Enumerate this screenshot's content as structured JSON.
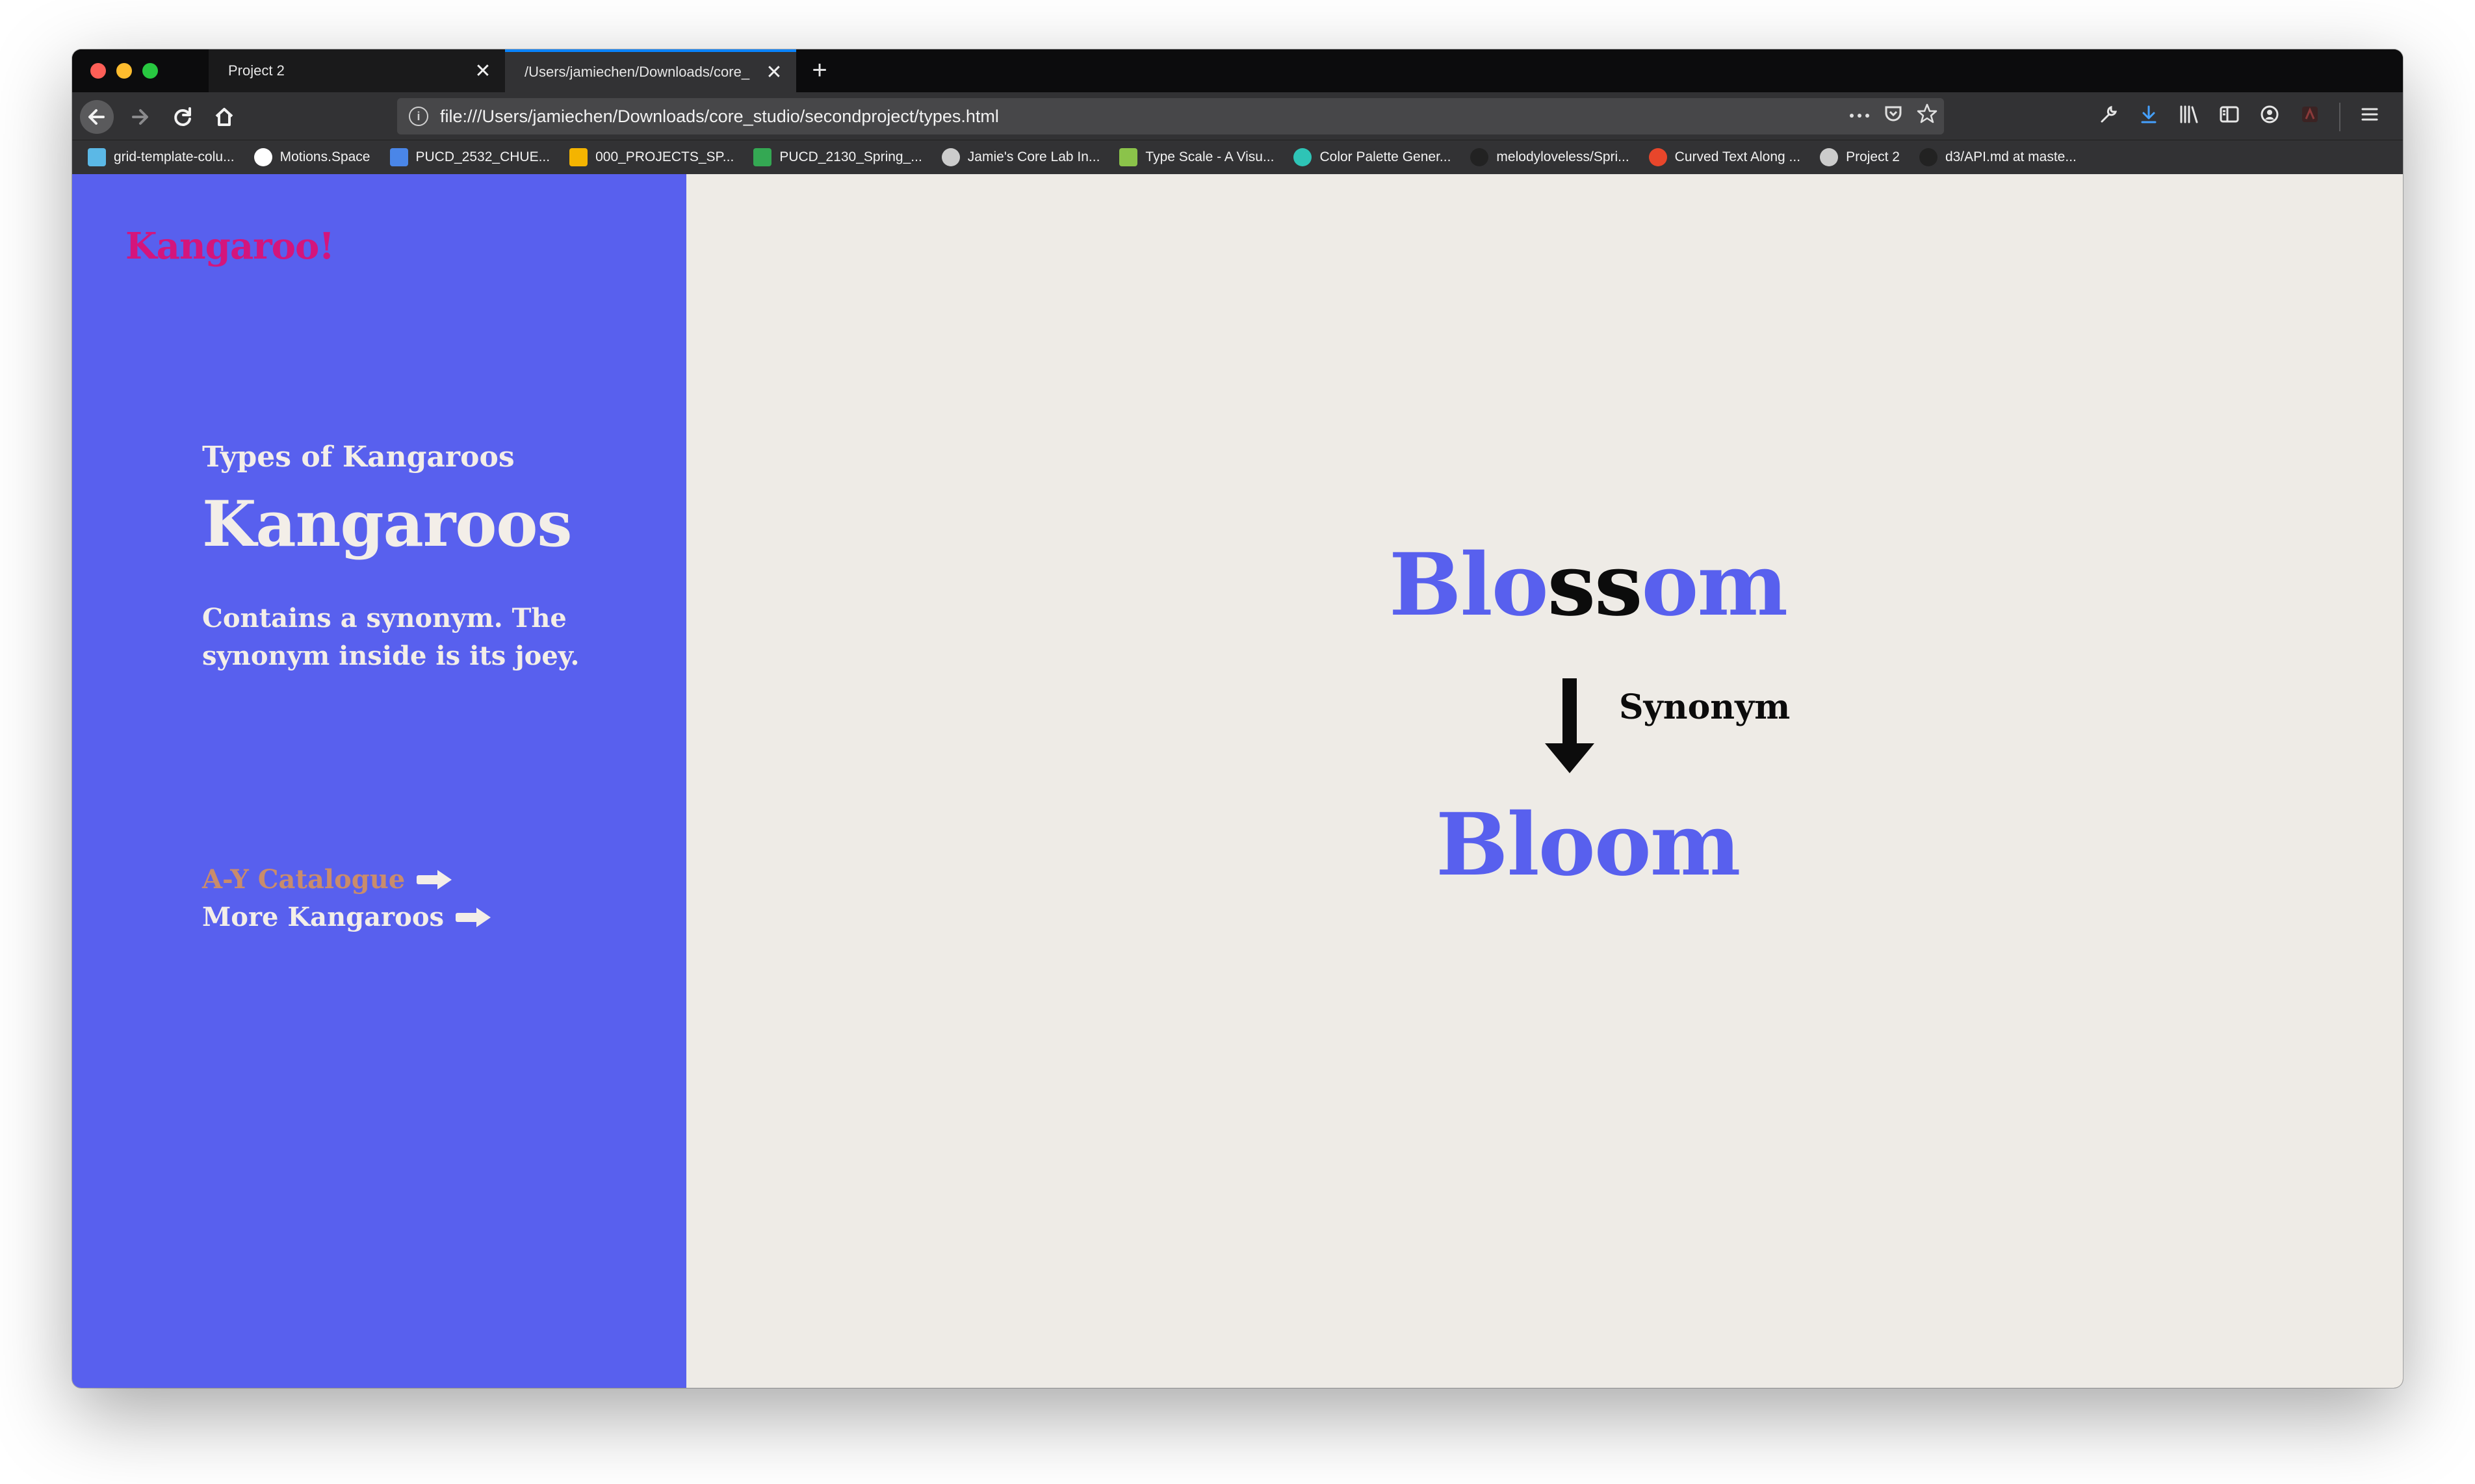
{
  "browser": {
    "tabs": [
      {
        "label": "Project 2",
        "close": "✕"
      },
      {
        "label": "/Users/jamiechen/Downloads/core_",
        "close": "✕"
      }
    ],
    "new_tab": "+",
    "url": "file:///Users/jamiechen/Downloads/core_studio/secondproject/types.html",
    "info_icon": "i",
    "bookmarks": [
      {
        "label": "grid-template-colu...",
        "icon": "codepen-icon",
        "color": "#5bb8e6"
      },
      {
        "label": "Motions.Space",
        "icon": "circle-icon",
        "color": "#ffffff"
      },
      {
        "label": "PUCD_2532_CHUE...",
        "icon": "docs-icon",
        "color": "#4a86e8"
      },
      {
        "label": "000_PROJECTS_SP...",
        "icon": "drive-icon",
        "color": "#f4b400"
      },
      {
        "label": "PUCD_2130_Spring_...",
        "icon": "drive-icon",
        "color": "#34a853"
      },
      {
        "label": "Jamie's Core Lab In...",
        "icon": "globe-icon",
        "color": "#cccccc"
      },
      {
        "label": "Type Scale - A Visu...",
        "icon": "type-scale-icon",
        "color": "#8bc34a"
      },
      {
        "label": "Color Palette Gener...",
        "icon": "palette-icon",
        "color": "#2ec4b6"
      },
      {
        "label": "melodyloveless/Spri...",
        "icon": "github-icon",
        "color": "#222222"
      },
      {
        "label": "Curved Text Along ...",
        "icon": "codesandbox-icon",
        "color": "#e8462b"
      },
      {
        "label": "Project 2",
        "icon": "globe-icon",
        "color": "#cccccc"
      },
      {
        "label": "d3/API.md at maste...",
        "icon": "github-icon",
        "color": "#222222"
      }
    ]
  },
  "page": {
    "logo": "Kangaroo!",
    "kicker": "Types of Kangaroos",
    "title": "Kangaroos",
    "description": "Contains a synonym. The synonym inside is its joey.",
    "links": [
      {
        "label": "A-Y Catalogue"
      },
      {
        "label": "More Kangaroos"
      }
    ],
    "word_top_parts": [
      "Blo",
      "ss",
      "om"
    ],
    "word_bottom": "Bloom",
    "synonym_label": "Synonym",
    "colors": {
      "sidebar": "#5860ee",
      "logo": "#d4157c",
      "link_active": "#c98c6b",
      "content_bg": "#eeebe6"
    }
  }
}
